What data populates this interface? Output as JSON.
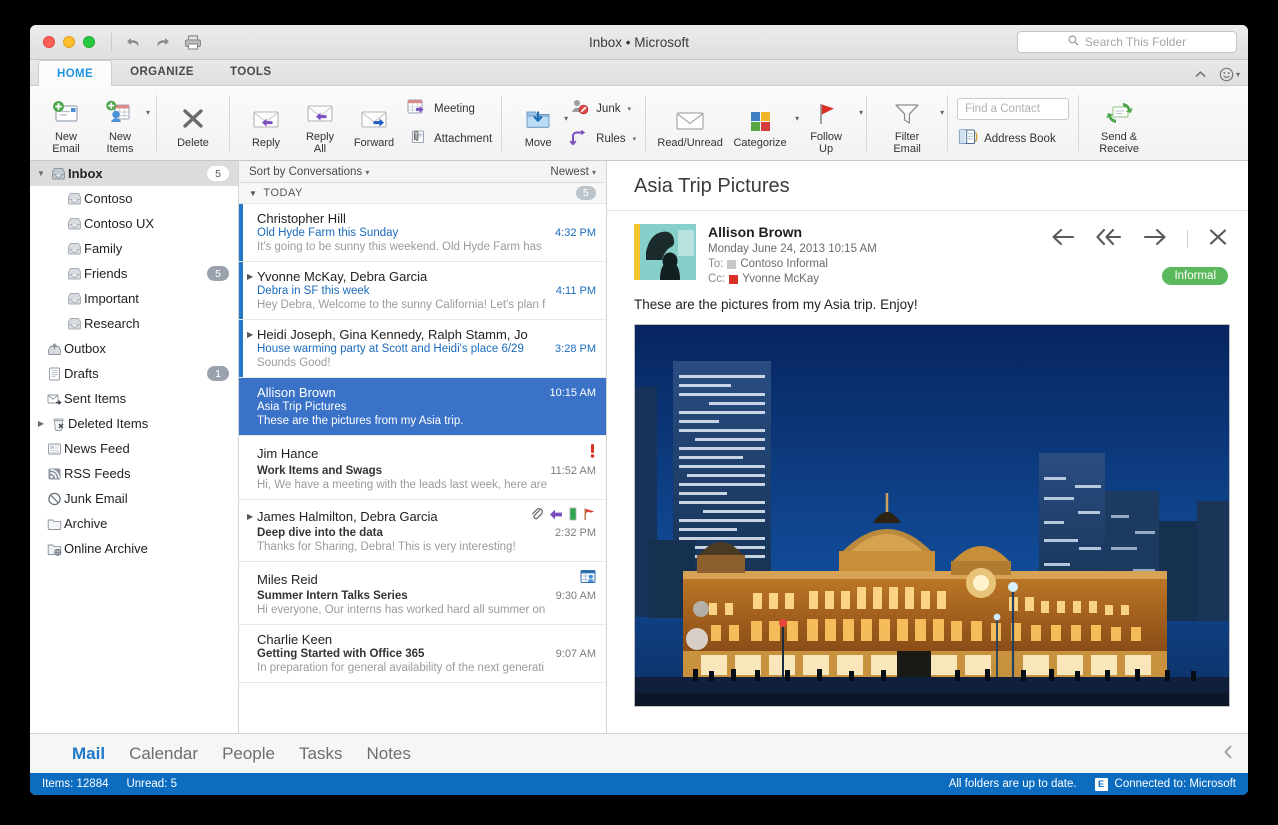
{
  "window": {
    "title": "Inbox • Microsoft",
    "traffic_lights": [
      "close",
      "minimize",
      "maximize"
    ],
    "undo_label": "Undo",
    "redo_label": "Redo",
    "print_label": "Print"
  },
  "search": {
    "placeholder": "Search This Folder",
    "icon": "search-icon"
  },
  "ribbon_tabs": [
    {
      "label": "HOME",
      "active": true
    },
    {
      "label": "ORGANIZE",
      "active": false
    },
    {
      "label": "TOOLS",
      "active": false
    }
  ],
  "ribbon": {
    "new_email": "New\nEmail",
    "new_email_l1": "New",
    "new_email_l2": "Email",
    "new_items_l1": "New",
    "new_items_l2": "Items",
    "delete": "Delete",
    "reply": "Reply",
    "reply_all_l1": "Reply",
    "reply_all_l2": "All",
    "forward": "Forward",
    "meeting": "Meeting",
    "attachment": "Attachment",
    "move": "Move",
    "junk": "Junk",
    "rules": "Rules",
    "read_unread": "Read/Unread",
    "categorize": "Categorize",
    "follow_up_l1": "Follow",
    "follow_up_l2": "Up",
    "filter_email_l1": "Filter",
    "filter_email_l2": "Email",
    "find_contact_placeholder": "Find a Contact",
    "address_book": "Address Book",
    "send_receive_l1": "Send &",
    "send_receive_l2": "Receive"
  },
  "sidebar": {
    "items": [
      {
        "label": "Inbox",
        "icon": "inbox-icon",
        "level": "root",
        "badge": "5",
        "badge_style": "light",
        "selected": true,
        "disclosure": "down",
        "bold": true
      },
      {
        "label": "Contoso",
        "icon": "inbox-icon",
        "level": "child",
        "badge": "",
        "badge_style": "",
        "selected": false,
        "disclosure": "",
        "bold": false
      },
      {
        "label": "Contoso UX",
        "icon": "inbox-icon",
        "level": "child",
        "badge": "",
        "badge_style": "",
        "selected": false,
        "disclosure": "",
        "bold": false
      },
      {
        "label": "Family",
        "icon": "inbox-icon",
        "level": "child",
        "badge": "",
        "badge_style": "",
        "selected": false,
        "disclosure": "",
        "bold": false
      },
      {
        "label": "Friends",
        "icon": "inbox-icon",
        "level": "child",
        "badge": "5",
        "badge_style": "grey",
        "selected": false,
        "disclosure": "",
        "bold": false
      },
      {
        "label": "Important",
        "icon": "inbox-icon",
        "level": "child",
        "badge": "",
        "badge_style": "",
        "selected": false,
        "disclosure": "",
        "bold": false
      },
      {
        "label": "Research",
        "icon": "inbox-icon",
        "level": "child",
        "badge": "",
        "badge_style": "",
        "selected": false,
        "disclosure": "",
        "bold": false
      },
      {
        "label": "Outbox",
        "icon": "outbox-icon",
        "level": "top",
        "badge": "",
        "badge_style": "",
        "selected": false,
        "disclosure": "",
        "bold": false
      },
      {
        "label": "Drafts",
        "icon": "drafts-icon",
        "level": "top",
        "badge": "1",
        "badge_style": "grey",
        "selected": false,
        "disclosure": "",
        "bold": false
      },
      {
        "label": "Sent Items",
        "icon": "sent-icon",
        "level": "top",
        "badge": "",
        "badge_style": "",
        "selected": false,
        "disclosure": "",
        "bold": false
      },
      {
        "label": "Deleted Items",
        "icon": "trash-icon",
        "level": "top",
        "badge": "",
        "badge_style": "",
        "selected": false,
        "disclosure": "right",
        "bold": false
      },
      {
        "label": "News Feed",
        "icon": "newsfeed-icon",
        "level": "top",
        "badge": "",
        "badge_style": "",
        "selected": false,
        "disclosure": "",
        "bold": false
      },
      {
        "label": "RSS Feeds",
        "icon": "rss-icon",
        "level": "top",
        "badge": "",
        "badge_style": "",
        "selected": false,
        "disclosure": "",
        "bold": false
      },
      {
        "label": "Junk Email",
        "icon": "junk-icon",
        "level": "top",
        "badge": "",
        "badge_style": "",
        "selected": false,
        "disclosure": "",
        "bold": false
      },
      {
        "label": "Archive",
        "icon": "folder-icon",
        "level": "top",
        "badge": "",
        "badge_style": "",
        "selected": false,
        "disclosure": "",
        "bold": false
      },
      {
        "label": "Online Archive",
        "icon": "online-archive-icon",
        "level": "top",
        "badge": "",
        "badge_style": "",
        "selected": false,
        "disclosure": "",
        "bold": false
      }
    ]
  },
  "message_list": {
    "sort_label": "Sort by Conversations",
    "order_label": "Newest",
    "group": {
      "label": "TODAY",
      "count": "5"
    },
    "items": [
      {
        "from": "Christopher Hill",
        "subject": "Old Hyde Farm this Sunday",
        "preview": "It's going to be sunny this weekend. Old Hyde Farm has",
        "time": "4:32 PM",
        "unread": true,
        "selected": false,
        "conversation": false,
        "icons": []
      },
      {
        "from": "Yvonne McKay, Debra Garcia",
        "subject": "Debra in SF this week",
        "preview": "Hey Debra, Welcome to the sunny California! Let's plan f",
        "time": "4:11 PM",
        "unread": true,
        "selected": false,
        "conversation": true,
        "icons": []
      },
      {
        "from": "Heidi Joseph, Gina Kennedy, Ralph Stamm, Jo",
        "subject": "House warming party at Scott and Heidi's place 6/29",
        "preview": "Sounds Good!",
        "time": "3:28 PM",
        "unread": true,
        "selected": false,
        "conversation": true,
        "icons": []
      },
      {
        "from": "Allison Brown",
        "subject": "Asia Trip Pictures",
        "preview": "These are the pictures from my Asia trip.",
        "time": "10:15 AM",
        "unread": false,
        "selected": true,
        "conversation": false,
        "icons": []
      },
      {
        "from": "Jim Hance",
        "subject": "Work Items and Swags",
        "preview": "Hi, We have a meeting with the leads last week, here are",
        "time": "11:52 AM",
        "unread": false,
        "selected": false,
        "conversation": false,
        "icons": [
          "importance-high-icon"
        ]
      },
      {
        "from": "James Halmilton, Debra Garcia",
        "subject": "Deep dive into the data",
        "preview": "Thanks for Sharing, Debra! This is very interesting!",
        "time": "2:32 PM",
        "unread": false,
        "selected": false,
        "conversation": true,
        "icons": [
          "attachment-icon",
          "replied-icon",
          "category-green-icon",
          "flag-icon"
        ]
      },
      {
        "from": "Miles Reid",
        "subject": "Summer Intern Talks Series",
        "preview": "Hi everyone, Our interns has worked hard all summer on",
        "time": "9:30 AM",
        "unread": false,
        "selected": false,
        "conversation": false,
        "icons": [
          "meeting-icon"
        ]
      },
      {
        "from": "Charlie Keen",
        "subject": "Getting Started with Office 365",
        "preview": "In preparation for general availability of the next generati",
        "time": "9:07 AM",
        "unread": false,
        "selected": false,
        "conversation": false,
        "icons": []
      }
    ]
  },
  "reading_pane": {
    "subject": "Asia Trip Pictures",
    "sender": "Allison Brown",
    "date": "Monday June 24, 2013 10:15 AM",
    "to_label": "To:",
    "to_value": "Contoso Informal",
    "to_color": "#c8c8c8",
    "cc_label": "Cc:",
    "cc_value": "Yvonne McKay",
    "cc_color": "#d93025",
    "category_badge": "Informal",
    "category_badge_color": "#5cb85c",
    "body_text": "These are the pictures from my Asia trip.   Enjoy!",
    "actions": [
      "reply-icon",
      "reply-all-icon",
      "forward-icon",
      "close-icon"
    ],
    "image_alt": "Tokyo Station at night"
  },
  "bottom_nav": {
    "items": [
      {
        "label": "Mail",
        "active": true
      },
      {
        "label": "Calendar",
        "active": false
      },
      {
        "label": "People",
        "active": false
      },
      {
        "label": "Tasks",
        "active": false
      },
      {
        "label": "Notes",
        "active": false
      }
    ],
    "collapse_icon": "chevron-left-icon"
  },
  "status_bar": {
    "items_count": "Items: 12884",
    "unread_count": "Unread: 5",
    "sync_status": "All folders are up to date.",
    "account_icon": "exchange-icon",
    "connection": "Connected to: Microsoft",
    "background": "#0b6cc0"
  }
}
